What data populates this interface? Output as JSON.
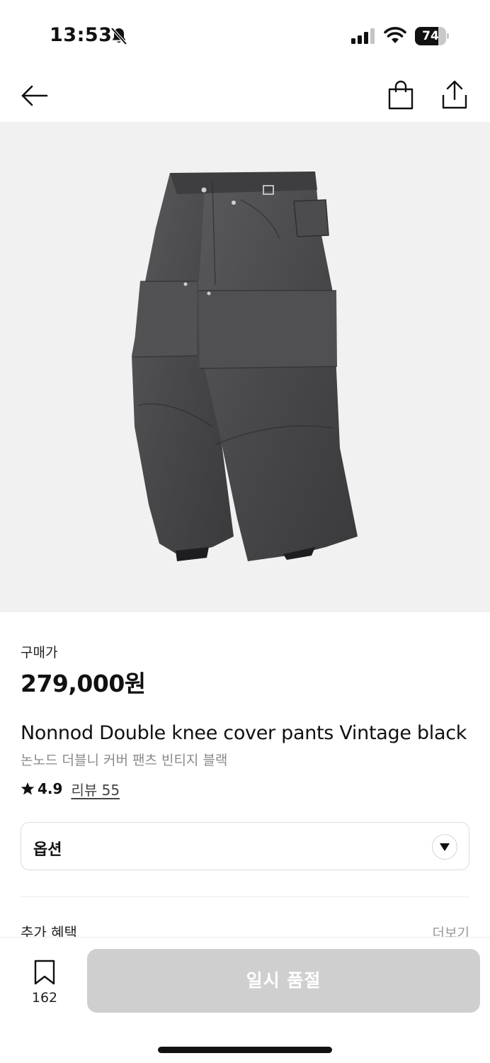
{
  "status_bar": {
    "time": "13:53",
    "battery": "74",
    "battery_level": 0.74,
    "icons": [
      "bell-slash-icon",
      "cellular-signal-icon",
      "wifi-icon",
      "battery-icon"
    ]
  },
  "nav": {
    "icons": [
      "arrow-left-icon",
      "shopping-bag-icon",
      "share-icon"
    ]
  },
  "product": {
    "image_icon": "product-photo",
    "price_label": "구매가",
    "price": "279,000원",
    "title": "Nonnod Double knee cover pants Vintage black",
    "subtitle": "논노드 더블니 커버 팬츠 빈티지 블랙",
    "rating": "4.9",
    "review_link": "리뷰 55"
  },
  "options": {
    "label": "옵션"
  },
  "benefits": {
    "label": "추가 혜택",
    "more": "더보기"
  },
  "bottom_bar": {
    "bookmark_count": "162",
    "soldout_label": "일시 품절"
  },
  "colors": {
    "background": "#ffffff",
    "image_bg": "#f1f1f1",
    "text_primary": "#111111",
    "text_secondary": "#8a8a8a",
    "button_disabled": "#cfcfcf"
  }
}
